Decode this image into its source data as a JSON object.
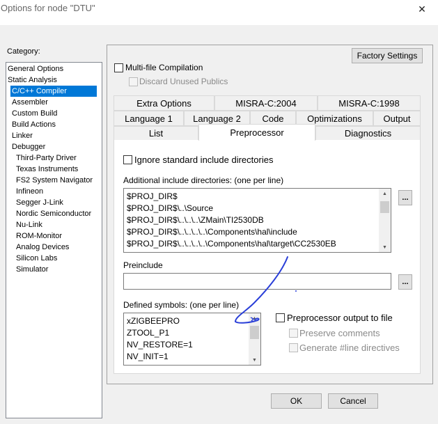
{
  "window": {
    "title": "Options for node \"DTU\"",
    "close_glyph": "✕"
  },
  "category": {
    "label": "Category:",
    "items": [
      {
        "label": "General Options"
      },
      {
        "label": "Static Analysis"
      },
      {
        "label": "C/C++ Compiler",
        "selected": true
      },
      {
        "label": "Assembler"
      },
      {
        "label": "Custom Build"
      },
      {
        "label": "Build Actions"
      },
      {
        "label": "Linker"
      },
      {
        "label": "Debugger"
      },
      {
        "label": "Third-Party Driver"
      },
      {
        "label": "Texas Instruments"
      },
      {
        "label": "FS2 System Navigator"
      },
      {
        "label": "Infineon"
      },
      {
        "label": "Segger J-Link"
      },
      {
        "label": "Nordic Semiconductor"
      },
      {
        "label": "Nu-Link"
      },
      {
        "label": "ROM-Monitor"
      },
      {
        "label": "Analog Devices"
      },
      {
        "label": "Silicon Labs"
      },
      {
        "label": "Simulator"
      }
    ]
  },
  "buttons": {
    "factory_settings": "Factory Settings",
    "ok": "OK",
    "cancel": "Cancel",
    "browse": "..."
  },
  "multifile": {
    "label": "Multi-file Compilation",
    "checked": false
  },
  "discard_unused": {
    "label": "Discard Unused Publics",
    "checked": false
  },
  "tabs": {
    "row1": [
      "Extra Options",
      "MISRA-C:2004",
      "MISRA-C:1998"
    ],
    "row2": [
      "Language 1",
      "Language 2",
      "Code",
      "Optimizations",
      "Output"
    ],
    "row3": [
      "List",
      "Preprocessor",
      "Diagnostics"
    ],
    "active": "Preprocessor"
  },
  "preprocessor": {
    "ignore_std_label": "Ignore standard include directories",
    "ignore_std_checked": false,
    "include_label": "Additional include directories: (one per line)",
    "include_lines": [
      "$PROJ_DIR$",
      "$PROJ_DIR$\\..\\Source",
      "$PROJ_DIR$\\..\\..\\..\\ZMain\\TI2530DB",
      "$PROJ_DIR$\\..\\..\\..\\..\\Components\\hal\\include",
      "$PROJ_DIR$\\..\\..\\..\\..\\Components\\hal\\target\\CC2530EB"
    ],
    "preinclude_label": "Preinclude",
    "preinclude_value": "",
    "defined_label": "Defined symbols: (one per line)",
    "defined_lines": [
      "xZIGBEEPRO",
      "ZTOOL_P1",
      "NV_RESTORE=1",
      "NV_INIT=1"
    ],
    "output_to_file_label": "Preprocessor output to file",
    "output_to_file_checked": false,
    "preserve_comments_label": "Preserve comments",
    "generate_line_label": "Generate #line directives"
  }
}
